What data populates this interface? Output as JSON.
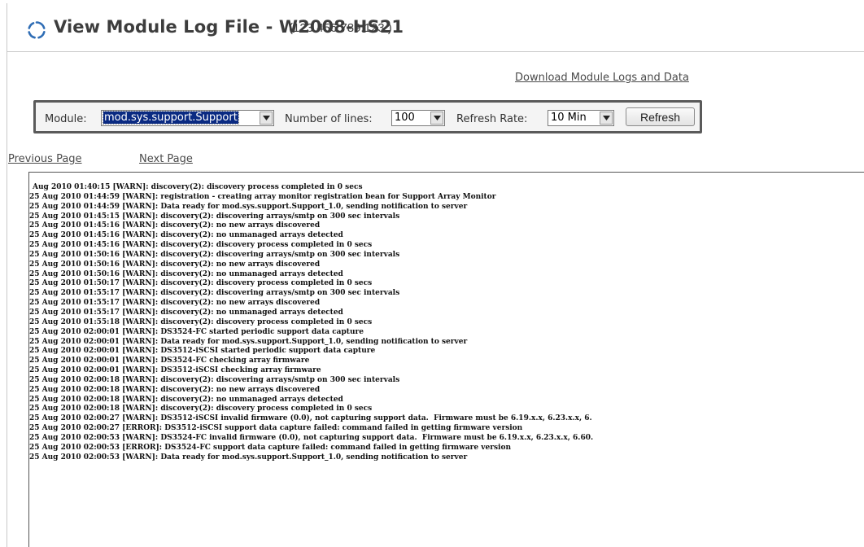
{
  "header": {
    "title": "View Module Log File - W2008-HS21",
    "ip": "(123.456.789.123   )",
    "icon": "refresh-circle-icon"
  },
  "links": {
    "download": "Download Module Logs and Data",
    "previous_page": "Previous Page",
    "next_page": "Next Page"
  },
  "controls": {
    "module_label": "Module:",
    "module_value": "mod.sys.support.Support",
    "lines_label": "Number of lines:",
    "lines_value": "100",
    "refresh_rate_label": "Refresh Rate:",
    "refresh_rate_value": "10 Min",
    "refresh_button": "Refresh"
  },
  "log": {
    "lines": [
      "Aug 2010 01:40:15 [WARN]: discovery(2): discovery process completed in 0 secs",
      "25 Aug 2010 01:44:59 [WARN]: registration - creating array monitor registration bean for Support Array Monitor",
      "25 Aug 2010 01:44:59 [WARN]: Data ready for mod.sys.support.Support_1.0, sending notification to server",
      "25 Aug 2010 01:45:15 [WARN]: discovery(2): discovering arrays/smtp on 300 sec intervals",
      "25 Aug 2010 01:45:16 [WARN]: discovery(2): no new arrays discovered",
      "25 Aug 2010 01:45:16 [WARN]: discovery(2): no unmanaged arrays detected",
      "25 Aug 2010 01:45:16 [WARN]: discovery(2): discovery process completed in 0 secs",
      "25 Aug 2010 01:50:16 [WARN]: discovery(2): discovering arrays/smtp on 300 sec intervals",
      "25 Aug 2010 01:50:16 [WARN]: discovery(2): no new arrays discovered",
      "25 Aug 2010 01:50:16 [WARN]: discovery(2): no unmanaged arrays detected",
      "25 Aug 2010 01:50:17 [WARN]: discovery(2): discovery process completed in 0 secs",
      "25 Aug 2010 01:55:17 [WARN]: discovery(2): discovering arrays/smtp on 300 sec intervals",
      "25 Aug 2010 01:55:17 [WARN]: discovery(2): no new arrays discovered",
      "25 Aug 2010 01:55:17 [WARN]: discovery(2): no unmanaged arrays detected",
      "25 Aug 2010 01:55:18 [WARN]: discovery(2): discovery process completed in 0 secs",
      "25 Aug 2010 02:00:01 [WARN]: DS3524-FC started periodic support data capture",
      "25 Aug 2010 02:00:01 [WARN]: Data ready for mod.sys.support.Support_1.0, sending notification to server",
      "25 Aug 2010 02:00:01 [WARN]: DS3512-iSCSI started periodic support data capture",
      "25 Aug 2010 02:00:01 [WARN]: DS3524-FC checking array firmware",
      "25 Aug 2010 02:00:01 [WARN]: DS3512-iSCSI checking array firmware",
      "25 Aug 2010 02:00:18 [WARN]: discovery(2): discovering arrays/smtp on 300 sec intervals",
      "25 Aug 2010 02:00:18 [WARN]: discovery(2): no new arrays discovered",
      "25 Aug 2010 02:00:18 [WARN]: discovery(2): no unmanaged arrays detected",
      "25 Aug 2010 02:00:18 [WARN]: discovery(2): discovery process completed in 0 secs",
      "25 Aug 2010 02:00:27 [WARN]: DS3512-iSCSI invalid firmware (0.0), not capturing support data.  Firmware must be 6.19.x.x, 6.23.x.x, 6.",
      "25 Aug 2010 02:00:27 [ERROR]: DS3512-iSCSI support data capture failed: command failed in getting firmware version",
      "25 Aug 2010 02:00:53 [WARN]: DS3524-FC invalid firmware (0.0), not capturing support data.  Firmware must be 6.19.x.x, 6.23.x.x, 6.60.",
      "25 Aug 2010 02:00:53 [ERROR]: DS3524-FC support data capture failed: command failed in getting firmware version",
      "25 Aug 2010 02:00:53 [WARN]: Data ready for mod.sys.support.Support_1.0, sending notification to server"
    ]
  }
}
